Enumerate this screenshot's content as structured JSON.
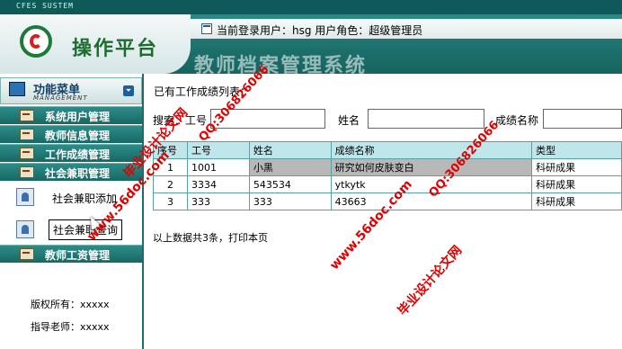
{
  "app": {
    "system_label": "CFES SUSTEM",
    "logo_title": "操作平台",
    "system_title": "教师档案管理系统"
  },
  "header": {
    "login_info": "当前登录用户：hsg  用户角色：超级管理员"
  },
  "sidebar": {
    "menu_title": "功能菜单",
    "menu_subtitle": "MANAGEMENT",
    "collapse_glyph": "⏷",
    "items": [
      {
        "label": "系统用户管理"
      },
      {
        "label": "教师信息管理"
      },
      {
        "label": "工作成绩管理"
      },
      {
        "label": "社会兼职管理"
      },
      {
        "label": "教师工资管理"
      }
    ],
    "subitems": [
      {
        "label": "社会兼职添加"
      },
      {
        "label": "社会兼职查询"
      }
    ],
    "copyright": "版权所有：xxxxx",
    "advisor": "指导老师：xxxxx"
  },
  "main": {
    "list_title": "已有工作成绩列表：",
    "search": {
      "gonghao_label": "搜索：工号",
      "gonghao_value": "",
      "name_label": "姓名",
      "name_value": "",
      "score_label": "成绩名称",
      "score_value": ""
    },
    "table": {
      "headers": [
        "序号",
        "工号",
        "姓名",
        "成绩名称",
        "类型"
      ],
      "rows": [
        [
          "1",
          "1001",
          "小黑",
          "研究如何皮肤变白",
          "科研成果"
        ],
        [
          "2",
          "3334",
          "543534",
          "ytkytk",
          "科研成果"
        ],
        [
          "3",
          "333",
          "333",
          "43663",
          "科研成果"
        ]
      ]
    },
    "footer_note": "以上数据共3条，打印本页"
  },
  "watermarks": {
    "qq": "QQ:306826066",
    "site": "www.56doc.com",
    "name": "毕业设计论文网"
  },
  "colors": {
    "accent": "#1d6f6b",
    "header_table": "#bfe6ea",
    "watermark": "#e00000"
  }
}
